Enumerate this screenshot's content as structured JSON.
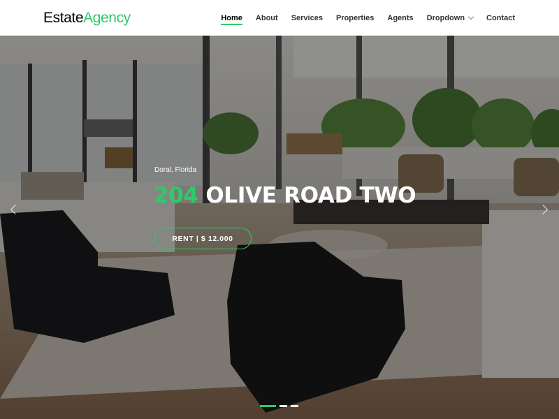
{
  "brand": {
    "part1": "Estate",
    "part2": "Agency"
  },
  "nav": {
    "items": [
      {
        "label": "Home",
        "active": true
      },
      {
        "label": "About"
      },
      {
        "label": "Services"
      },
      {
        "label": "Properties"
      },
      {
        "label": "Agents"
      },
      {
        "label": "Dropdown",
        "icon": "chevron-down-icon"
      },
      {
        "label": "Contact"
      }
    ]
  },
  "hero": {
    "location": "Doral, Florida",
    "number": "204",
    "title": "OLIVE ROAD TWO",
    "price_button": "RENT | $ 12.000",
    "prev_icon": "chevron-left-icon",
    "next_icon": "chevron-right-icon",
    "slides_total": 3,
    "slide_active": 1
  },
  "colors": {
    "accent": "#2eca6a",
    "text_dark": "#000000",
    "nav_text": "#333333"
  }
}
